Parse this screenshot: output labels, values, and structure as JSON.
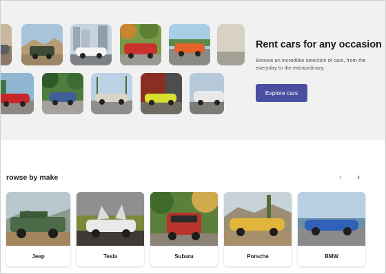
{
  "hero": {
    "title": "Rent cars for any occasion",
    "subtitle": "Browse an incredible selection of cars, from the everyday to the extraordinary.",
    "cta_label": "Explore cars"
  },
  "browse": {
    "title": "rowse by make",
    "prev_arrow": "‹",
    "next_arrow": "›",
    "makes": [
      {
        "label": "Jeep"
      },
      {
        "label": "Tesla"
      },
      {
        "label": "Subaru"
      },
      {
        "label": "Porsche"
      },
      {
        "label": "BMW"
      }
    ]
  },
  "colors": {
    "accent": "#4a4fa0",
    "hero_background": "#f1f1f2"
  }
}
